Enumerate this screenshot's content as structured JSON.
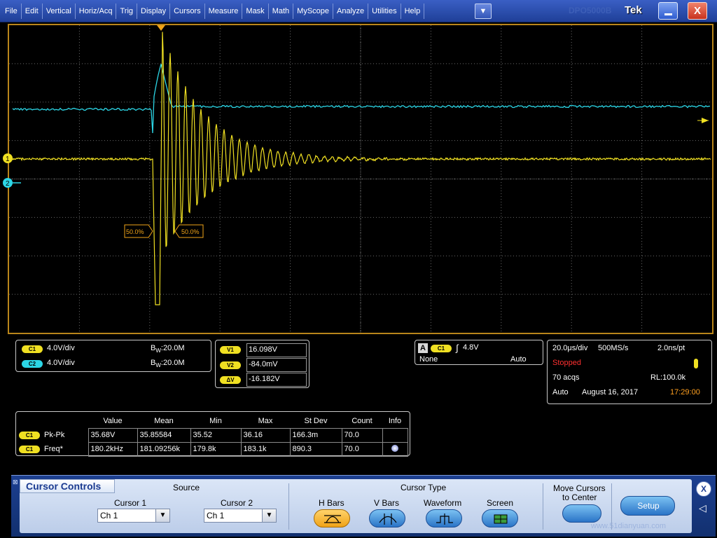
{
  "menubar": {
    "items": [
      "File",
      "Edit",
      "Vertical",
      "Horiz/Acq",
      "Trig",
      "Display",
      "Cursors",
      "Measure",
      "Mask",
      "Math",
      "MyScope",
      "Analyze",
      "Utilities",
      "Help"
    ],
    "dropdown_glyph": "▼",
    "brand": "Tek",
    "brand_ghost": "DPO5000B",
    "close_glyph": "X"
  },
  "graticule": {
    "markers": {
      "ch1": "1",
      "ch2": "2"
    },
    "cursor_labels": [
      "50.0%",
      "50.0%"
    ]
  },
  "channels": [
    {
      "badge": "C1",
      "scale": "4.0V/div",
      "bw_label": "B",
      "bw_sub": "W",
      "bw_value": ":20.0M",
      "color": "#f0e022"
    },
    {
      "badge": "C2",
      "scale": "4.0V/div",
      "bw_label": "B",
      "bw_sub": "W",
      "bw_value": ":20.0M",
      "color": "#2cd6e6"
    }
  ],
  "cursor_readout": {
    "v1_label": "V1",
    "v1": "16.098V",
    "v2_label": "V2",
    "v2": "-84.0mV",
    "dv_label": "ΔV",
    "dv": "-16.182V"
  },
  "trigger": {
    "letter": "A",
    "source": "C1",
    "slope_glyph": "∫",
    "level": "4.8V",
    "coupling": "None",
    "mode": "Auto"
  },
  "acquisition": {
    "timebase": "20.0μs/div",
    "sample_rate": "500MS/s",
    "resolution": "2.0ns/pt",
    "status": "Stopped",
    "acqs": "70 acqs",
    "record_length": "RL:100.0k",
    "mode": "Auto",
    "date": "August 16, 2017",
    "time": "17:29:00"
  },
  "measurements": {
    "headers": [
      "Value",
      "Mean",
      "Min",
      "Max",
      "St Dev",
      "Count",
      "Info"
    ],
    "rows": [
      {
        "badge": "C1",
        "name": "Pk-Pk",
        "value": "35.68V",
        "mean": "35.85584",
        "min": "35.52",
        "max": "36.16",
        "stdev": "166.3m",
        "count": "70.0",
        "info": ""
      },
      {
        "badge": "C1",
        "name": "Freq*",
        "value": "180.2kHz",
        "mean": "181.09256k",
        "min": "179.8k",
        "max": "183.1k",
        "stdev": "890.3",
        "count": "70.0",
        "info": "info-icon"
      }
    ]
  },
  "cursor_controls": {
    "title": "Cursor Controls",
    "source_label": "Source",
    "cursor1_label": "Cursor 1",
    "cursor1_value": "Ch 1",
    "cursor2_label": "Cursor 2",
    "cursor2_value": "Ch 1",
    "cursor_type_label": "Cursor Type",
    "types": [
      "H Bars",
      "V Bars",
      "Waveform",
      "Screen"
    ],
    "active_type": "H Bars",
    "move_label_1": "Move Cursors",
    "move_label_2": "to Center",
    "setup_label": "Setup",
    "close_glyph": "X",
    "watermark": "www.51dianyuan.com"
  },
  "colors": {
    "ch1": "#f0e022",
    "ch2": "#2cd6e6",
    "frame": "#b9851a",
    "menubar": "#2b4fb0",
    "stopped": "#ff3030",
    "time": "#ffa020"
  }
}
